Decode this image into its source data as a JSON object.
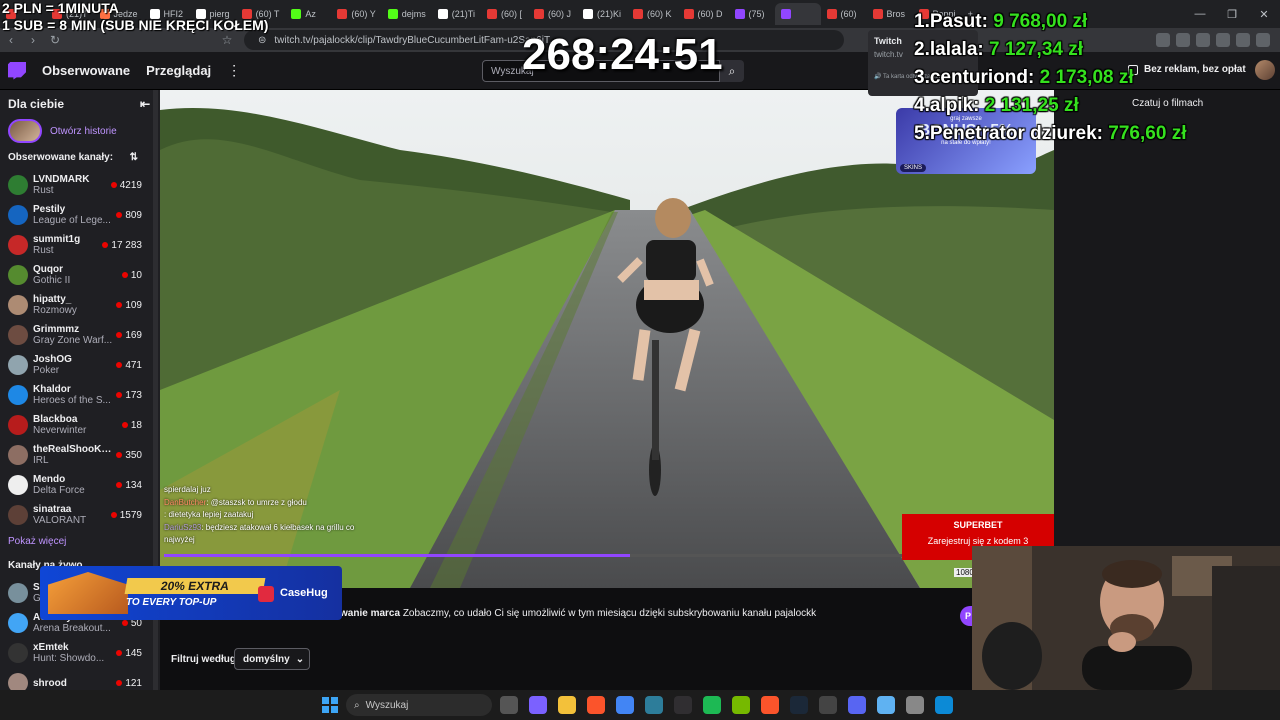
{
  "browser": {
    "tabs": [
      {
        "label": "",
        "color": "#e53935"
      },
      {
        "label": "(21)T",
        "color": "#e53935"
      },
      {
        "label": "Jedze",
        "color": "#ff7043"
      },
      {
        "label": "HFI2",
        "color": "#ffffff"
      },
      {
        "label": "pierg",
        "color": "#ffffff"
      },
      {
        "label": "(60) T",
        "color": "#e53935"
      },
      {
        "label": "Az",
        "color": "#53fc18"
      },
      {
        "label": "(60) Y",
        "color": "#e53935"
      },
      {
        "label": "dejms",
        "color": "#53fc18"
      },
      {
        "label": "(21)Ti",
        "color": "#ffffff"
      },
      {
        "label": "(60) [",
        "color": "#e53935"
      },
      {
        "label": "(60) J",
        "color": "#e53935"
      },
      {
        "label": "(21)Ki",
        "color": "#ffffff"
      },
      {
        "label": "(60) K",
        "color": "#e53935"
      },
      {
        "label": "(60) D",
        "color": "#e53935"
      },
      {
        "label": "(75)",
        "color": "#9146ff"
      },
      {
        "label": "",
        "color": "#9146ff"
      },
      {
        "label": "(60)",
        "color": "#e53935"
      },
      {
        "label": "Bros",
        "color": "#e53935"
      },
      {
        "label": "Poppi",
        "color": "#e53935"
      }
    ],
    "new_tab": "+",
    "window_controls": [
      "—",
      "❐",
      "✕"
    ],
    "url": "twitch.tv/pajalockk/clip/TawdryBlueCucumberLitFam-u2Sap6iT...",
    "twitch_popup": {
      "title": "Twitch",
      "domain": "twitch.tv",
      "note": "Ta karta odtwarza dźwięk"
    }
  },
  "header": {
    "nav": [
      "Obserwowane",
      "Przeglądaj"
    ],
    "more": "⋮",
    "search_placeholder": "Wyszukaj",
    "ads_free": "Bez reklam, bez opłat",
    "clip_label": "Czatuj o filmach"
  },
  "sidebar": {
    "title": "Dla ciebie",
    "history_label": "Otwórz historie",
    "followed_title": "Obserwowane kanały:",
    "channels": [
      {
        "name": "LVNDMARK",
        "game": "Rust",
        "viewers": "4219",
        "color": "#2e7d32"
      },
      {
        "name": "Pestily",
        "game": "League of Lege...",
        "viewers": "809",
        "color": "#1565c0"
      },
      {
        "name": "summit1g",
        "game": "Rust",
        "viewers": "17 283",
        "color": "#c62828"
      },
      {
        "name": "Quqor",
        "game": "Gothic II",
        "viewers": "10",
        "color": "#558b2f"
      },
      {
        "name": "hipatty_",
        "game": "Rozmowy",
        "viewers": "109",
        "color": "#ad8b73"
      },
      {
        "name": "Grimmmz",
        "game": "Gray Zone Warf...",
        "viewers": "169",
        "color": "#6d4c41"
      },
      {
        "name": "JoshOG",
        "game": "Poker",
        "viewers": "471",
        "color": "#90a4ae"
      },
      {
        "name": "Khaldor",
        "game": "Heroes of the S...",
        "viewers": "173",
        "color": "#1e88e5"
      },
      {
        "name": "Blackboa",
        "game": "Neverwinter",
        "viewers": "18",
        "color": "#b71c1c"
      },
      {
        "name": "theRealShooKo...",
        "game": "IRL",
        "viewers": "350",
        "color": "#8d6e63"
      },
      {
        "name": "Mendo",
        "game": "Delta Force",
        "viewers": "134",
        "color": "#eeeeee"
      },
      {
        "name": "sinatraa",
        "game": "VALORANT",
        "viewers": "1579",
        "color": "#5d4037"
      }
    ],
    "show_more": "Pokaż więcej",
    "live_title": "Kanały na żywo",
    "live_channels": [
      {
        "name": "She...",
        "game": "Gra...",
        "viewers": "",
        "color": "#78909c"
      },
      {
        "name": "ActuallyAtom",
        "game": "Arena Breakout...",
        "viewers": "50",
        "color": "#42a5f5"
      },
      {
        "name": "xEmtek",
        "game": "Hunt: Showdo...",
        "viewers": "145",
        "color": "#333333"
      },
      {
        "name": "shrood",
        "game": "",
        "viewers": "121",
        "color": "#a1887f"
      }
    ]
  },
  "video": {
    "chat": [
      {
        "user": "",
        "text": "spierdalaj juz"
      },
      {
        "user": "DanButcher",
        "text": ": @staszsk to umrze z głodu"
      },
      {
        "user": "",
        "text": ": dietetyka lepiej zaatakuj"
      },
      {
        "user": "DariuSz93",
        "text": ": będziesz atakował 6 kiełbasek na grillu co najwyżej"
      }
    ],
    "progress": 0.63,
    "superbet": {
      "brand": "SUPERBET",
      "cta": "Zarejestruj się z kodem",
      "num": "3"
    },
    "resolution": "1080"
  },
  "bonus_banner": {
    "line1": "graj zawsze",
    "main": "BONUS +5%",
    "line2": "na stałe do wpłaty!",
    "tag": "SKINS"
  },
  "below": {
    "sub_title": "wanie marca",
    "sub_text": "Zobaczmy, co udało Ci się umożliwić w tym miesiącu dzięki subskrybowaniu kanału pajalockk",
    "filter_label": "Filtruj według",
    "filter_value": "domyślny",
    "chip": "P"
  },
  "ad": {
    "pill": "20% EXTRA",
    "sub": "TO EVERY TOP-UP",
    "brand": "CaseHug"
  },
  "overlays": {
    "line1": "2 PLN = 1MINUTA",
    "line2": "1 SUB = 8 MIN (SUB NIE KRĘCI KOŁEM)",
    "timer": "268:24:51",
    "leaderboard": [
      {
        "rank": "1.",
        "name": "Pasut:",
        "amount": "9 768,00 zł"
      },
      {
        "rank": "2.",
        "name": "lalala:",
        "amount": "7 127,34 zł"
      },
      {
        "rank": "3.",
        "name": "centuriond:",
        "amount": "2 173,08 zł"
      },
      {
        "rank": "4.",
        "name": "alpik:",
        "amount": "2 131,25 zł"
      },
      {
        "rank": "5.",
        "name": "Penetrator dziurek:",
        "amount": "776,60 zł"
      }
    ]
  },
  "taskbar": {
    "search_label": "Wyszukaj",
    "apps": [
      {
        "name": "task-view",
        "color": "#555555"
      },
      {
        "name": "copilot",
        "color": "#7b61ff"
      },
      {
        "name": "explorer",
        "color": "#f3c13a"
      },
      {
        "name": "brave",
        "color": "#fb542b"
      },
      {
        "name": "chrome",
        "color": "#4285f4"
      },
      {
        "name": "photos",
        "color": "#2d7d9a"
      },
      {
        "name": "obs",
        "color": "#302e31"
      },
      {
        "name": "spotify",
        "color": "#1db954"
      },
      {
        "name": "nvidia",
        "color": "#76b900"
      },
      {
        "name": "brave-2",
        "color": "#fb542b"
      },
      {
        "name": "steam",
        "color": "#1b2838"
      },
      {
        "name": "calculator",
        "color": "#444444"
      },
      {
        "name": "discord",
        "color": "#5865f2"
      },
      {
        "name": "notepad",
        "color": "#5fb2f2"
      },
      {
        "name": "settings",
        "color": "#888888"
      },
      {
        "name": "edge",
        "color": "#0c8ad6"
      }
    ]
  }
}
